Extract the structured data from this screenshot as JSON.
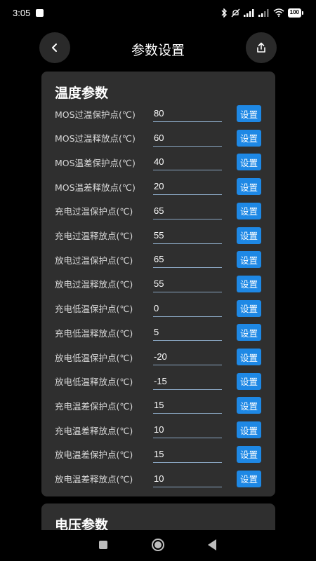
{
  "status_bar": {
    "time": "3:05",
    "signal1": "ııll",
    "signal2": "ııll",
    "battery": "100"
  },
  "header": {
    "title": "参数设置"
  },
  "temperature_section": {
    "title": "温度参数",
    "button_label": "设置",
    "rows": [
      {
        "label": "MOS过温保护点(℃)",
        "value": "80"
      },
      {
        "label": "MOS过温释放点(℃)",
        "value": "60"
      },
      {
        "label": "MOS温差保护点(℃)",
        "value": "40"
      },
      {
        "label": "MOS温差释放点(℃)",
        "value": "20"
      },
      {
        "label": "充电过温保护点(℃)",
        "value": "65"
      },
      {
        "label": "充电过温释放点(℃)",
        "value": "55"
      },
      {
        "label": "放电过温保护点(℃)",
        "value": "65"
      },
      {
        "label": "放电过温释放点(℃)",
        "value": "55"
      },
      {
        "label": "充电低温保护点(℃)",
        "value": "0"
      },
      {
        "label": "充电低温释放点(℃)",
        "value": "5"
      },
      {
        "label": "放电低温保护点(℃)",
        "value": "-20"
      },
      {
        "label": "放电低温释放点(℃)",
        "value": "-15"
      },
      {
        "label": "充电温差保护点(℃)",
        "value": "15"
      },
      {
        "label": "充电温差释放点(℃)",
        "value": "10"
      },
      {
        "label": "放电温差保护点(℃)",
        "value": "15"
      },
      {
        "label": "放电温差释放点(℃)",
        "value": "10"
      }
    ]
  },
  "voltage_section": {
    "title": "电压参数"
  },
  "colors": {
    "background": "#000000",
    "card": "#2f2f2f",
    "accent_button": "#1e88e5",
    "input_underline": "#8aa6c2"
  },
  "icons": {
    "back": "chevron-left-icon",
    "share": "share-upload-icon"
  }
}
